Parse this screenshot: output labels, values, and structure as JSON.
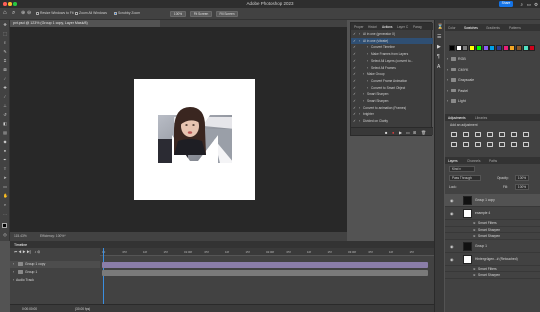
{
  "window": {
    "title": "Adobe Photoshop 2023",
    "share_label": "Share"
  },
  "colors": {
    "accent": "#1473e6",
    "selection": "#2f4f73",
    "canvas_bg": "#282828"
  },
  "options_bar": {
    "resize_windows": "Resize Windows to Fit",
    "zoom_all": "Zoom All Windows",
    "scrubby_zoom": "Scrubby Zoom",
    "zoom_value": "100%",
    "fit_screen": "Fit Screen",
    "fill_screen": "Fill Screen"
  },
  "document": {
    "tab_title": "pvt.psd @ 123% (Group 1 copy, Layer Mask/8)",
    "zoom": "115.43%",
    "efficiency": "Efficiency: 100%*"
  },
  "actions_panel": {
    "tabs": [
      "Proper",
      "Histori",
      "Actions",
      "Layer C",
      "Parag"
    ],
    "active_tab": "Actions",
    "rows": [
      {
        "label": "AI in one (generator X)",
        "indent": 1
      },
      {
        "label": "AI in one (vibrate)",
        "indent": 1
      },
      {
        "label": "Convert Timeline",
        "indent": 3
      },
      {
        "label": "Make Frames from Layers",
        "indent": 3
      },
      {
        "label": "Select All Layers (convert to...",
        "indent": 3
      },
      {
        "label": "Select All Frames",
        "indent": 3
      },
      {
        "label": "Make Group",
        "indent": 2
      },
      {
        "label": "Convert Frame Animation",
        "indent": 3
      },
      {
        "label": "Convert to Smart Object",
        "indent": 3
      },
      {
        "label": "Smart Sharpen",
        "indent": 2
      },
      {
        "label": "Smart Sharpen",
        "indent": 2
      },
      {
        "label": "Convert to animation (Frames)",
        "indent": 1
      },
      {
        "label": "brighter",
        "indent": 1
      },
      {
        "label": "Divided on Clarity",
        "indent": 1
      }
    ]
  },
  "right_panel": {
    "swatch_tabs": [
      "Color",
      "Swatches",
      "Gradients",
      "Patterns"
    ],
    "active_swatch_tab": "Swatches",
    "swatch_groups": [
      "RGB",
      "CMYK",
      "Grayscale",
      "Pastel",
      "Light"
    ],
    "adjust_tabs": [
      "Adjustments",
      "Libraries"
    ],
    "add_adjustment": "Add an adjustment",
    "layer_tabs": [
      "Layers",
      "Channels",
      "Paths"
    ],
    "kind_label": "Kind",
    "blend_mode": "Pass Through",
    "opacity_label": "Opacity:",
    "opacity": "100%",
    "fill_label": "Fill:",
    "fill": "100%",
    "lock_label": "Lock:",
    "layers": [
      {
        "name": "Group 1 copy",
        "type": "group"
      },
      {
        "name": "example 4",
        "type": "layer"
      },
      {
        "name": "Smart Filters",
        "type": "filter"
      },
      {
        "name": "Smart Sharpen",
        "type": "filter"
      },
      {
        "name": "Smart Sharpen",
        "type": "filter"
      },
      {
        "name": "Group 1",
        "type": "group"
      },
      {
        "name": "Hintergrügen...# (Retouched)",
        "type": "layer"
      },
      {
        "name": "Smart Filters",
        "type": "filter"
      },
      {
        "name": "Smart Sharpen",
        "type": "filter"
      }
    ]
  },
  "timeline": {
    "title": "Timeline",
    "ticks": [
      "00",
      "05f",
      "10f",
      "15f",
      "01:00f",
      "05f",
      "10f",
      "15f",
      "02:00f",
      "05f",
      "10f",
      "15f",
      "03:00f",
      "05f",
      "10f",
      "15f"
    ],
    "tracks": [
      "Group 1 copy",
      "Group 1",
      "Audio Track"
    ],
    "timecode": "0:00:00:00",
    "fps": "(30.00 fps)"
  }
}
